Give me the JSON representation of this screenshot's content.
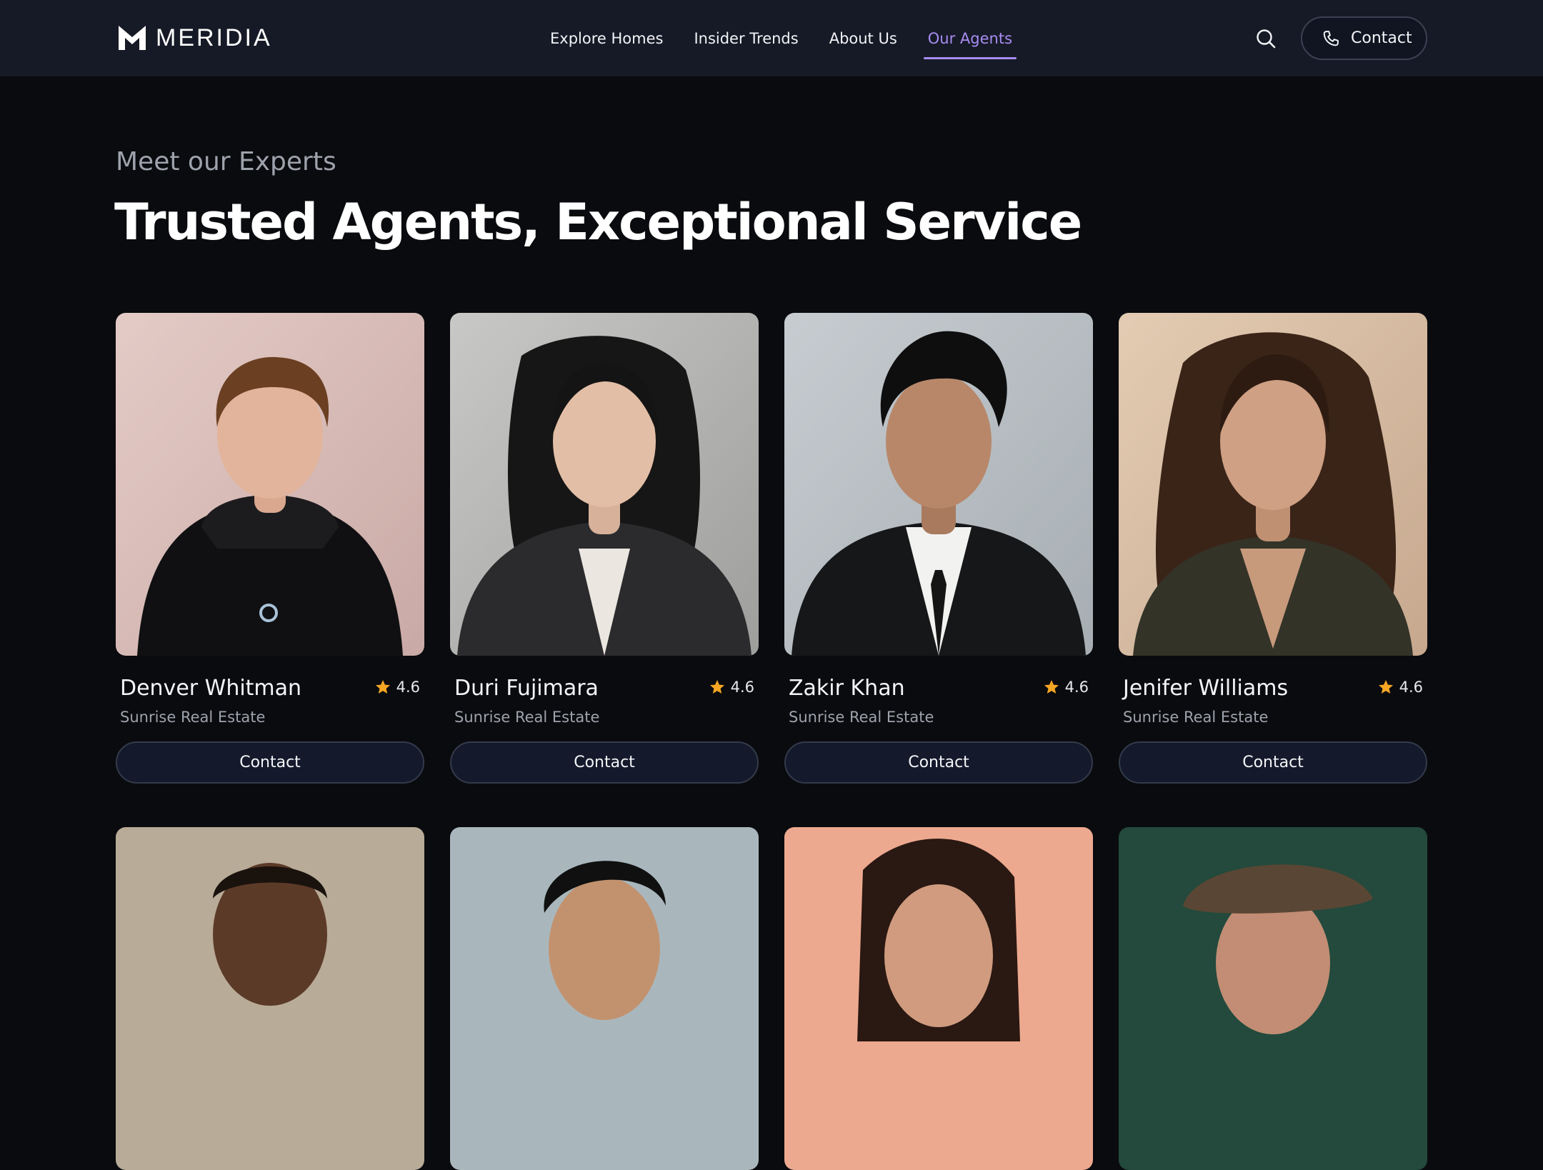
{
  "brand": {
    "name": "MERIDIA"
  },
  "nav": {
    "links": [
      {
        "label": "Explore Homes",
        "active": false
      },
      {
        "label": "Insider Trends",
        "active": false
      },
      {
        "label": "About Us",
        "active": false
      },
      {
        "label": "Our Agents",
        "active": true
      }
    ],
    "search_icon": "search-icon",
    "contact_label": "Contact",
    "contact_icon": "phone-icon"
  },
  "colors": {
    "accent": "#a88cf2",
    "star": "#f5a623",
    "background": "#0a0b0e",
    "nav_background": "#161a26"
  },
  "hero": {
    "eyebrow": "Meet our Experts",
    "headline": "Trusted Agents, Exceptional Service"
  },
  "agents": [
    {
      "name": "Denver Whitman",
      "rating": "4.6",
      "agency": "Sunrise Real Estate",
      "contact_label": "Contact"
    },
    {
      "name": "Duri Fujimara",
      "rating": "4.6",
      "agency": "Sunrise Real Estate",
      "contact_label": "Contact"
    },
    {
      "name": "Zakir Khan",
      "rating": "4.6",
      "agency": "Sunrise Real Estate",
      "contact_label": "Contact"
    },
    {
      "name": "Jenifer Williams",
      "rating": "4.6",
      "agency": "Sunrise Real Estate",
      "contact_label": "Contact"
    },
    {
      "name": "",
      "rating": "",
      "agency": "",
      "contact_label": ""
    },
    {
      "name": "",
      "rating": "",
      "agency": "",
      "contact_label": ""
    },
    {
      "name": "",
      "rating": "",
      "agency": "",
      "contact_label": ""
    },
    {
      "name": "",
      "rating": "",
      "agency": "",
      "contact_label": ""
    }
  ]
}
